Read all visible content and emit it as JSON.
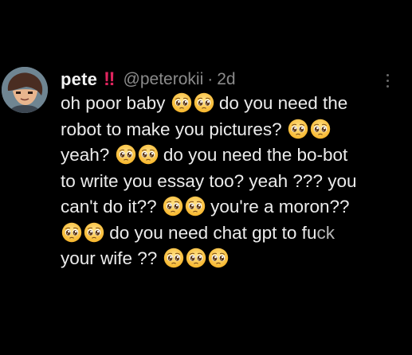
{
  "tweet": {
    "author": {
      "display_name": "pete",
      "badge": "‼",
      "handle": "@peterokii",
      "separator": "·",
      "timestamp": "2d"
    },
    "more_icon": "more-vertical-icon",
    "emoji_icon": "pleading-face-emoji",
    "lines": [
      [
        "oh poor baby ",
        "",
        "",
        " do you need the"
      ],
      [
        "robot to make you pictures? ",
        "",
        ""
      ],
      [
        "yeah? ",
        "",
        "",
        " do you need the bo-bot"
      ],
      [
        "to write you essay too? yeah ??? you"
      ],
      [
        "can't do it?? ",
        "",
        "",
        " you're a moron??"
      ],
      [
        "",
        "",
        " do you need chat gpt to fu",
        "ck"
      ],
      [
        "your wife ?? ",
        "",
        "",
        ""
      ]
    ]
  },
  "colors": {
    "background": "#000000",
    "text": "#ececec",
    "muted": "#8b8b8b",
    "badge": "#e0245e"
  }
}
